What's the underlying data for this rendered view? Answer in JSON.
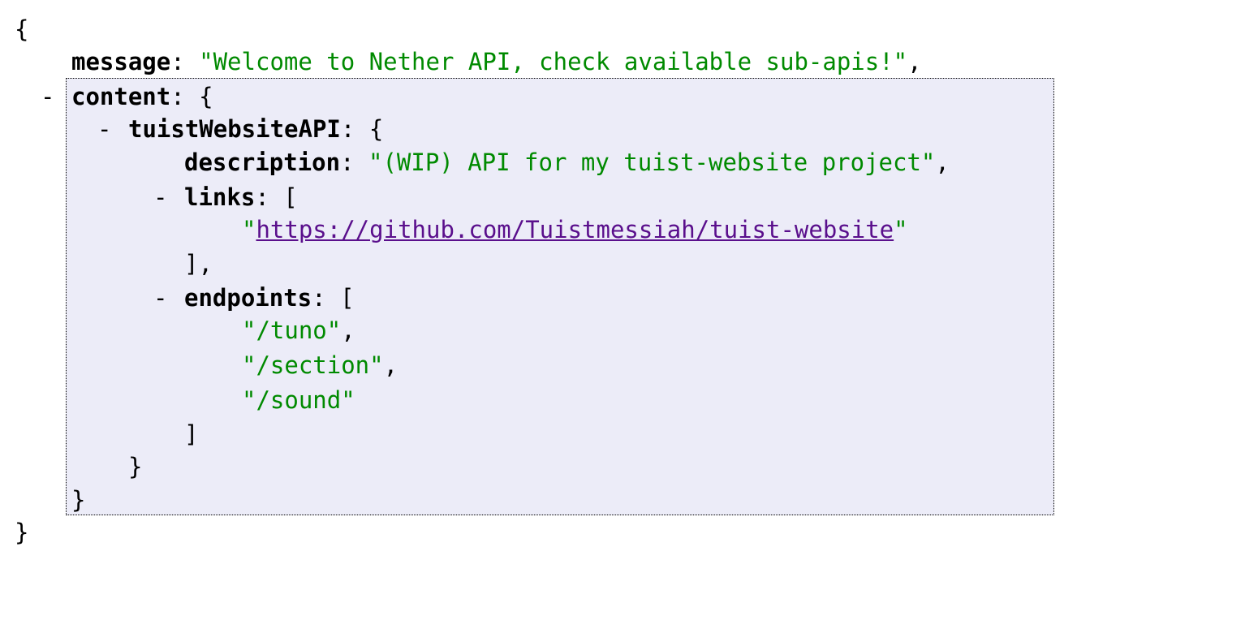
{
  "viewer": {
    "open_brace": "{",
    "close_brace": "}",
    "toggle_glyph": "-",
    "colon": ": ",
    "comma": ",",
    "quote": "\"",
    "message": {
      "key": "message",
      "value": "\"Welcome to Nether API, check available sub-apis!\""
    },
    "content": {
      "key": "content",
      "open": "{",
      "close": "}",
      "tuistWebsiteAPI": {
        "key": "tuistWebsiteAPI",
        "open": "{",
        "close": "}",
        "description": {
          "key": "description",
          "value": "\"(WIP) API for my tuist-website project\""
        },
        "links": {
          "key": "links",
          "open": "[",
          "close": "],",
          "items": [
            "https://github.com/Tuistmessiah/tuist-website"
          ]
        },
        "endpoints": {
          "key": "endpoints",
          "open": "[",
          "close": "]",
          "items": [
            "\"/tuno\"",
            "\"/section\"",
            "\"/sound\""
          ]
        }
      }
    }
  },
  "colors": {
    "string": "#008a00",
    "link": "#5a0f8c",
    "highlight_background": "#ececf8"
  }
}
